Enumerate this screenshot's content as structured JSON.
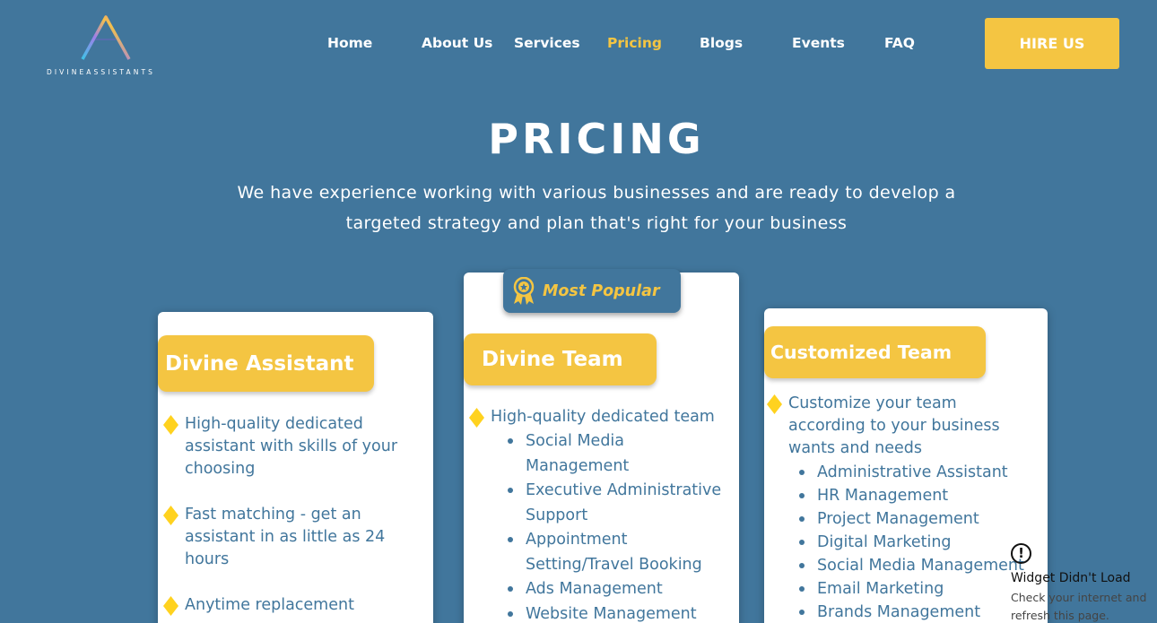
{
  "header": {
    "logo_text": "DIVINEASSISTANTS",
    "nav": [
      {
        "label": "Home"
      },
      {
        "label": "About Us"
      },
      {
        "label": "Services"
      },
      {
        "label": "Pricing",
        "active": true
      },
      {
        "label": "Blogs"
      },
      {
        "label": "Events"
      },
      {
        "label": "FAQ"
      }
    ],
    "cta_label": "HIRE US"
  },
  "hero": {
    "title": "PRICING",
    "subtitle_line1": "We have experience working with various businesses and are ready to develop a",
    "subtitle_line2": "targeted strategy and plan that's right for your business"
  },
  "plans": [
    {
      "title": "Divine Assistant",
      "features": [
        {
          "lines": [
            "High-quality dedicated",
            "assistant with skills of your",
            "choosing"
          ]
        },
        {
          "lines": [
            "Fast matching - get an",
            "assistant in as little as 24",
            "hours"
          ]
        },
        {
          "lines": [
            "Anytime replacement"
          ]
        }
      ]
    },
    {
      "title": "Divine Team",
      "badge": "Most Popular",
      "features": [
        {
          "lines": [
            "High-quality dedicated team"
          ]
        }
      ],
      "sub_items": [
        {
          "lines": [
            "Social Media",
            "Management"
          ]
        },
        {
          "lines": [
            "Executive Administrative",
            "Support"
          ]
        },
        {
          "lines": [
            "Appointment",
            "Setting/Travel Booking"
          ]
        },
        {
          "lines": [
            "Ads Management"
          ]
        },
        {
          "lines": [
            "Website Management"
          ]
        }
      ]
    },
    {
      "title": "Customized Team",
      "features": [
        {
          "lines": [
            "Customize your team",
            "according to your business",
            "wants and needs"
          ]
        }
      ],
      "sub_items": [
        {
          "lines": [
            "Administrative Assistant"
          ]
        },
        {
          "lines": [
            "HR Management"
          ]
        },
        {
          "lines": [
            "Project Management"
          ]
        },
        {
          "lines": [
            "Digital Marketing"
          ]
        },
        {
          "lines": [
            "Social Media Management"
          ]
        },
        {
          "lines": [
            "Email Marketing"
          ]
        },
        {
          "lines": [
            "Brands Management"
          ]
        }
      ]
    }
  ],
  "widget": {
    "title": "Widget Didn't Load",
    "message": "Check your internet and refresh this page."
  },
  "colors": {
    "background": "#41769C",
    "accent": "#F4C542",
    "card": "#FFFFFF",
    "text_on_card": "#41769C"
  },
  "icons": [
    "logo-triangle-icon",
    "award-ribbon-icon",
    "diamond-bullet-icon",
    "warning-icon"
  ]
}
